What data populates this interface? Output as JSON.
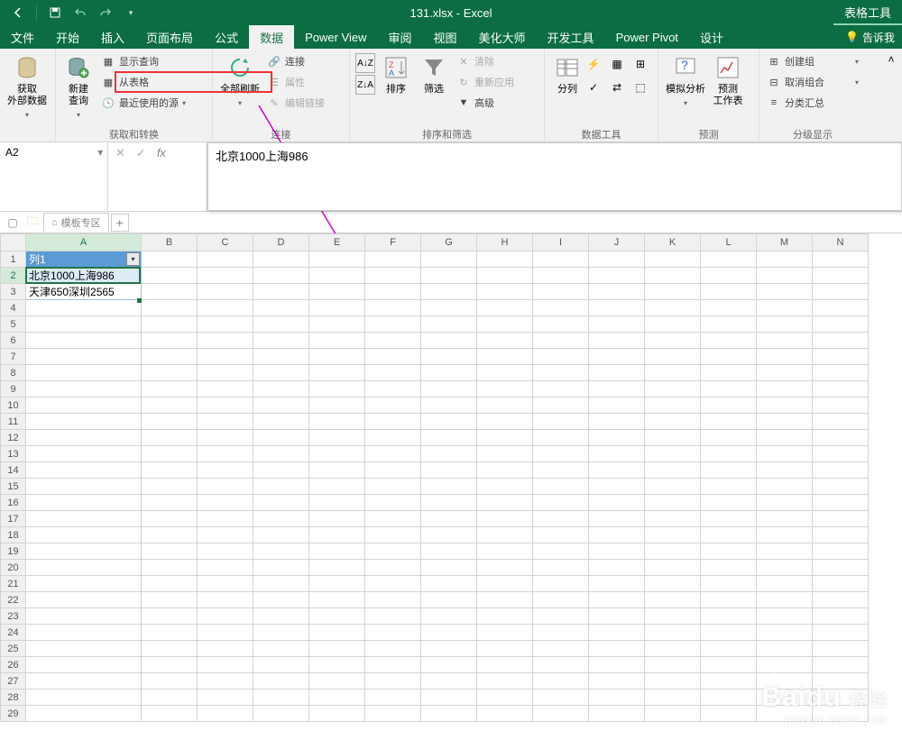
{
  "title": "131.xlsx - Excel",
  "contextTab": "表格工具",
  "menuTabs": {
    "file": "文件",
    "home": "开始",
    "insert": "插入",
    "pageLayout": "页面布局",
    "formulas": "公式",
    "data": "数据",
    "powerView": "Power View",
    "review": "审阅",
    "view": "视图",
    "beautify": "美化大师",
    "developer": "开发工具",
    "powerPivot": "Power Pivot",
    "design": "设计",
    "tellMe": "告诉我"
  },
  "ribbon": {
    "externalData": {
      "label": "获取\n外部数据",
      "group": ""
    },
    "getTransform": {
      "newQuery": "新建\n查询",
      "showQueries": "显示查询",
      "fromTable": "从表格",
      "recentSources": "最近使用的源",
      "group": "获取和转换"
    },
    "connections": {
      "refreshAll": "全部刷新",
      "connections": "连接",
      "properties": "属性",
      "editLinks": "编辑链接",
      "group": "连接"
    },
    "sortFilter": {
      "sort": "排序",
      "filter": "筛选",
      "clear": "清除",
      "reapply": "重新应用",
      "advanced": "高级",
      "group": "排序和筛选"
    },
    "dataTools": {
      "textToColumns": "分列",
      "group": "数据工具"
    },
    "forecast": {
      "whatIf": "模拟分析",
      "forecast": "预测\n工作表",
      "group": "预测"
    },
    "outline": {
      "group_": "创建组",
      "ungroup": "取消组合",
      "subtotal": "分类汇总",
      "group": "分级显示"
    }
  },
  "nameBox": "A2",
  "formulaValue": "北京1000上海986",
  "templateTab": "模板专区",
  "columns": [
    "A",
    "B",
    "C",
    "D",
    "E",
    "F",
    "G",
    "H",
    "I",
    "J",
    "K",
    "L",
    "M",
    "N"
  ],
  "rows": 29,
  "tableHeader": "列1",
  "cellA2": "北京1000上海986",
  "cellA3": "天津650深圳2565",
  "watermark": {
    "brand": "Baidu",
    "brandSuffix": "经验",
    "url": "jingyan.baidu.com"
  }
}
